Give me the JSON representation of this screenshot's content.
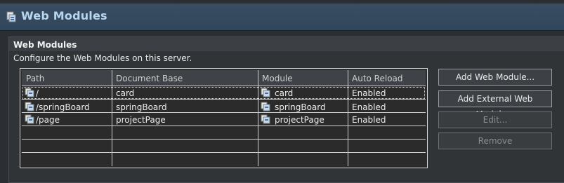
{
  "header": {
    "title": "Web Modules"
  },
  "section": {
    "title": "Web Modules",
    "description": "Configure the Web Modules on this server."
  },
  "table": {
    "columns": [
      "Path",
      "Document Base",
      "Module",
      "Auto Reload"
    ],
    "rows": [
      {
        "path": "/",
        "document_base": "card",
        "module": "card",
        "auto_reload": "Enabled"
      },
      {
        "path": "/springBoard",
        "document_base": "springBoard",
        "module": "springBoard",
        "auto_reload": "Enabled"
      },
      {
        "path": "/page",
        "document_base": "projectPage",
        "module": "projectPage",
        "auto_reload": "Enabled"
      }
    ]
  },
  "buttons": {
    "add_web_module": "Add Web Module...",
    "add_external_web_module": "Add External Web Module...",
    "edit": "Edit...",
    "remove": "Remove"
  },
  "icons": {
    "header": "web-module-icon",
    "row_path": "web-module-icon",
    "row_module": "web-module-icon"
  }
}
